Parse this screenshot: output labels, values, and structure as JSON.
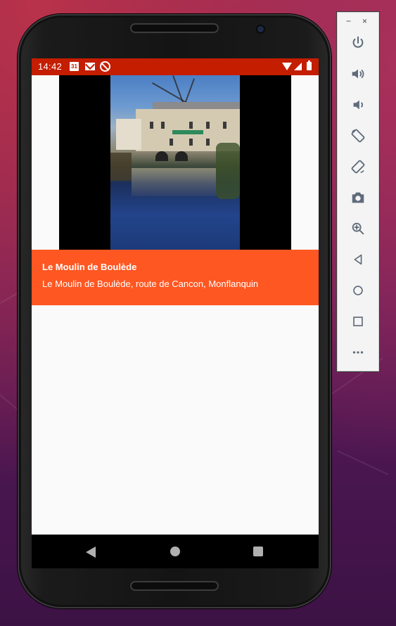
{
  "statusbar": {
    "time": "14:42",
    "calendar_day": "31",
    "color": "#c41d00"
  },
  "card": {
    "title": "Le Moulin de Boulède",
    "subtitle": "Le Moulin de Boulède, route de Cancon, Monflanquin",
    "color": "#ff5722"
  },
  "toolbar": {
    "minimize": "−",
    "close": "×",
    "buttons": [
      "power-icon",
      "volume-up-icon",
      "volume-down-icon",
      "rotate-left-icon",
      "rotate-right-icon",
      "camera-icon",
      "zoom-icon",
      "back-icon",
      "home-icon",
      "overview-icon",
      "more-icon"
    ]
  },
  "navbar": {
    "buttons": [
      "back-icon",
      "home-icon",
      "recent-apps-icon"
    ]
  }
}
